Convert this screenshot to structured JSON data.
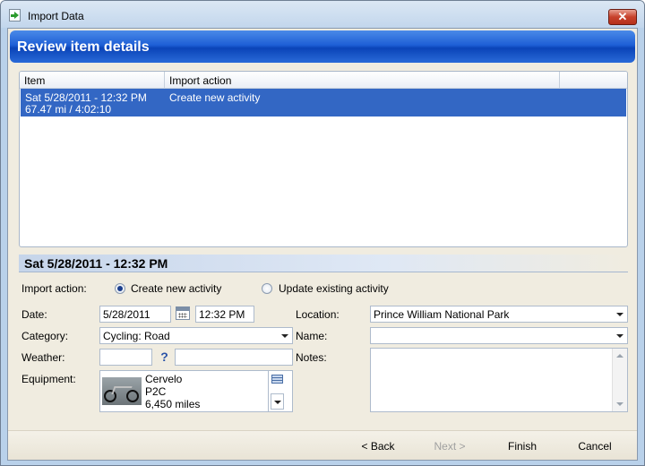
{
  "window": {
    "title": "Import Data",
    "close_symbol": "✕"
  },
  "banner": {
    "title": "Review item details"
  },
  "list": {
    "columns": [
      "Item",
      "Import action"
    ],
    "rows": [
      {
        "item_line1": "Sat 5/28/2011 - 12:32 PM",
        "item_line2": "67.47 mi  /  4:02:10",
        "action": "Create new activity",
        "selected": true
      }
    ]
  },
  "details": {
    "heading": "Sat 5/28/2011 - 12:32 PM",
    "import_action_label": "Import action:",
    "import_action_options": [
      "Create new activity",
      "Update existing activity"
    ],
    "import_action_selected": "Create new activity",
    "date_label": "Date:",
    "date_value": "5/28/2011",
    "time_value": "12:32 PM",
    "category_label": "Category:",
    "category_value": "Cycling: Road",
    "weather_label": "Weather:",
    "weather_value": "",
    "weather_desc": "",
    "equipment_label": "Equipment:",
    "equipment": {
      "make": "Cervelo",
      "model": "P2C",
      "distance": "6,450 miles"
    },
    "location_label": "Location:",
    "location_value": "Prince William National Park",
    "name_label": "Name:",
    "name_value": "",
    "notes_label": "Notes:",
    "notes_value": ""
  },
  "footer": {
    "back_label": "< Back",
    "next_label": "Next >",
    "finish_label": "Finish",
    "cancel_label": "Cancel"
  },
  "colors": {
    "selection": "#3367c4",
    "banner": "#1e5fd6",
    "close_button": "#c7412b"
  }
}
